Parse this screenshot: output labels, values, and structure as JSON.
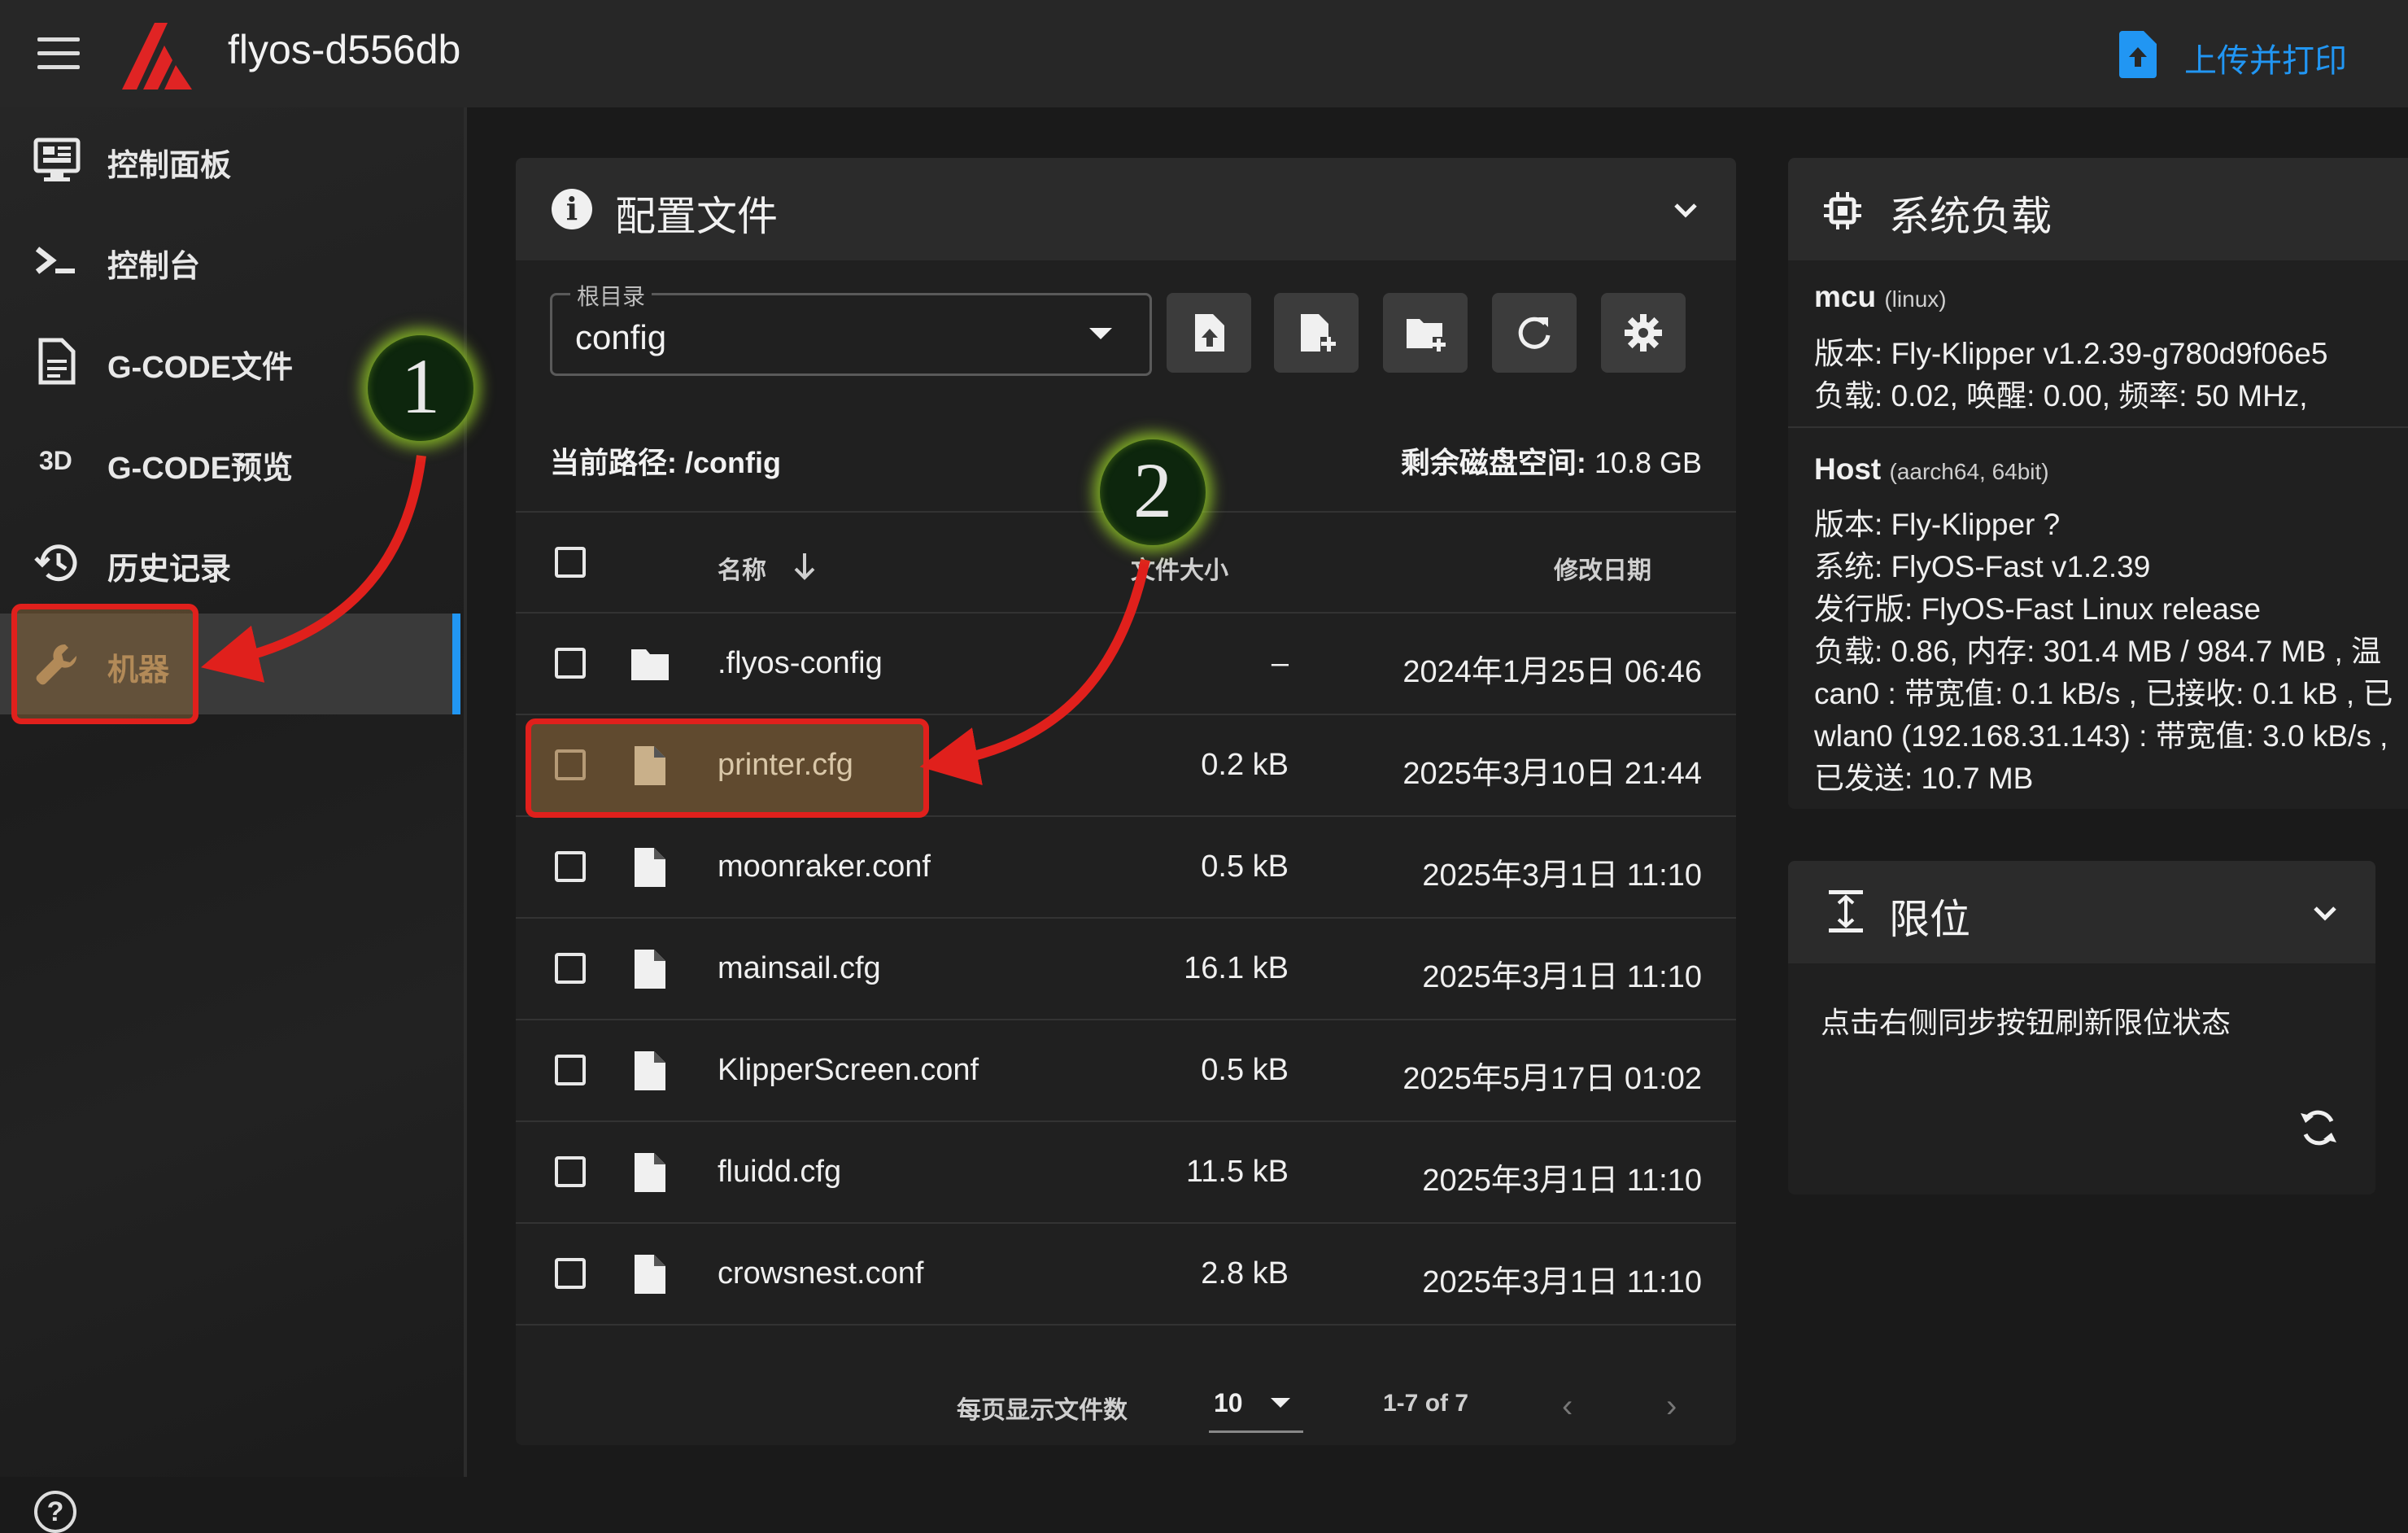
{
  "app": {
    "device_name": "flyos-d556db",
    "upload_print_label": "上传并打印"
  },
  "sidebar": {
    "items": [
      {
        "label": "控制面板",
        "icon": "monitor-dashboard-icon"
      },
      {
        "label": "控制台",
        "icon": "console-icon"
      },
      {
        "label": "G-CODE文件",
        "icon": "file-document-icon"
      },
      {
        "label": "G-CODE预览",
        "icon": "3d-icon",
        "icon_text": "3D"
      },
      {
        "label": "历史记录",
        "icon": "history-icon"
      },
      {
        "label": "机器",
        "icon": "wrench-icon",
        "active": true
      }
    ],
    "help_icon": "?"
  },
  "config_panel": {
    "title": "配置文件",
    "info_icon": "i",
    "root_select": {
      "legend": "根目录",
      "value": "config"
    },
    "toolbar": [
      "upload-file-icon",
      "new-file-icon",
      "new-folder-icon",
      "refresh-icon",
      "settings-icon"
    ],
    "current_path_label": "当前路径:",
    "current_path": "/config",
    "free_space_label": "剩余磁盘空间:",
    "free_space": "10.8 GB",
    "columns": {
      "name": "名称",
      "size": "文件大小",
      "modified": "修改日期"
    },
    "files": [
      {
        "name": ".flyos-config",
        "type": "folder",
        "size": "–",
        "modified": "2024年1月25日 06:46"
      },
      {
        "name": "printer.cfg",
        "type": "file",
        "size": "0.2 kB",
        "modified": "2025年3月10日 21:44",
        "highlighted": true
      },
      {
        "name": "moonraker.conf",
        "type": "file",
        "size": "0.5 kB",
        "modified": "2025年3月1日 11:10"
      },
      {
        "name": "mainsail.cfg",
        "type": "file",
        "size": "16.1 kB",
        "modified": "2025年3月1日 11:10"
      },
      {
        "name": "KlipperScreen.conf",
        "type": "file",
        "size": "0.5 kB",
        "modified": "2025年5月17日 01:02"
      },
      {
        "name": "fluidd.cfg",
        "type": "file",
        "size": "11.5 kB",
        "modified": "2025年3月1日 11:10"
      },
      {
        "name": "crowsnest.conf",
        "type": "file",
        "size": "2.8 kB",
        "modified": "2025年3月1日 11:10"
      }
    ],
    "footer": {
      "per_page_label": "每页显示文件数",
      "per_page": "10",
      "range": "1-7 of 7"
    }
  },
  "system_load": {
    "title": "系统负载",
    "mcu": {
      "name": "mcu",
      "arch": "(linux)",
      "version_line": "版本:  Fly-Klipper v1.2.39-g780d9f06e5",
      "load_line": "负载:  0.02, 唤醒:  0.00, 频率:  50 MHz,"
    },
    "host": {
      "name": "Host",
      "arch": "(aarch64, 64bit)",
      "lines": [
        "版本:  Fly-Klipper ?",
        "系统:  FlyOS-Fast v1.2.39",
        "发行版:  FlyOS-Fast Linux release",
        "负载:  0.86, 内存:  301.4 MB / 984.7 MB , 温",
        "can0 : 带宽值:  0.1 kB/s , 已接收:  0.1 kB , 已",
        "wlan0 (192.168.31.143) : 带宽值:  3.0 kB/s ,",
        "已发送:  10.7 MB"
      ]
    }
  },
  "endstops": {
    "title": "限位",
    "message": "点击右侧同步按钮刷新限位状态"
  },
  "annotations": {
    "marker_1": "1",
    "marker_2": "2"
  },
  "colors": {
    "accent": "#2196f3",
    "highlight_border": "#e0201c",
    "background": "#1a1a1a",
    "panel": "#202020",
    "panel_header": "#2b2b2b"
  }
}
